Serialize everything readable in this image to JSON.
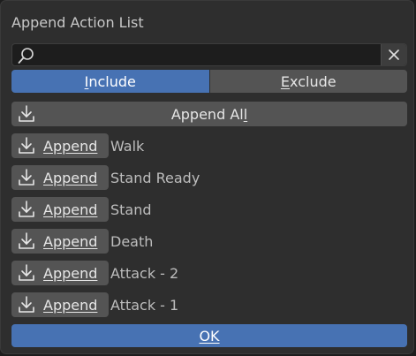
{
  "dialog": {
    "title": "Append Action List"
  },
  "search": {
    "value": "",
    "icon": "search-icon",
    "clear_icon": "close-icon"
  },
  "filter_toggle": {
    "include_first": "I",
    "include_rest": "nclude",
    "exclude_first": "E",
    "exclude_rest": "xclude",
    "active": "Include"
  },
  "append_all": {
    "label_start": "Append Al",
    "label_underlined": "l",
    "icon": "download-icon"
  },
  "actions": [
    {
      "button": "Append",
      "name": "Walk"
    },
    {
      "button": "Append",
      "name": "Stand Ready"
    },
    {
      "button": "Append",
      "name": "Stand"
    },
    {
      "button": "Append",
      "name": "Death"
    },
    {
      "button": "Append",
      "name": "Attack - 2"
    },
    {
      "button": "Append",
      "name": "Attack - 1"
    }
  ],
  "ok_button": {
    "label": "OK"
  },
  "colors": {
    "accent": "#4772b3",
    "button": "#545454",
    "panel": "#2e2e2e"
  }
}
